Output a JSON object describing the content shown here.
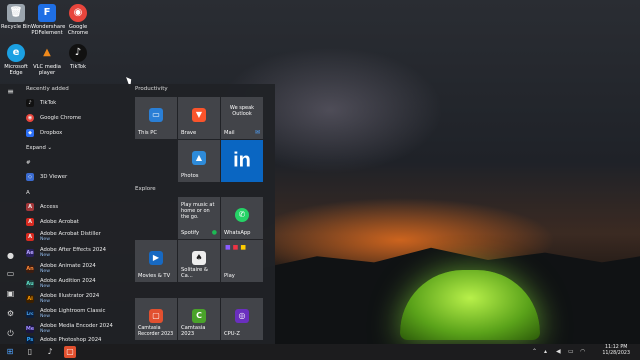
{
  "desktop_icons": [
    {
      "label": "Recycle Bin",
      "icon": "recycle-bin-icon",
      "glyph": "🗑",
      "color": "#9aa4ad"
    },
    {
      "label": "Wondershare PDFelement",
      "icon": "pdfelement-icon",
      "glyph": "F",
      "color": "#1f6fe5"
    },
    {
      "label": "Google Chrome",
      "icon": "chrome-icon",
      "glyph": "◉",
      "color": "#e8453c"
    },
    {
      "label": "Microsoft Edge",
      "icon": "edge-icon",
      "glyph": "e",
      "color": "#1ba0e2"
    },
    {
      "label": "VLC media player",
      "icon": "vlc-icon",
      "glyph": "▲",
      "color": "#f08a1c"
    },
    {
      "label": "TikTok",
      "icon": "tiktok-icon",
      "glyph": "♪",
      "color": "#111"
    }
  ],
  "start_menu": {
    "recently_added": "Recently added",
    "recent": [
      {
        "label": "TikTok",
        "color": "#111",
        "glyph": "♪"
      },
      {
        "label": "Google Chrome",
        "color": "#e8453c",
        "glyph": "◉"
      },
      {
        "label": "Dropbox",
        "color": "#2b6ff6",
        "glyph": "◆"
      }
    ],
    "expand": "Expand",
    "hash": "#",
    "view3d": "3D Viewer",
    "letter_a": "A",
    "apps": [
      {
        "label": "Access",
        "color": "#a4373a",
        "glyph": "A",
        "sub": ""
      },
      {
        "label": "Adobe Acrobat",
        "color": "#d82a20",
        "glyph": "A",
        "sub": ""
      },
      {
        "label": "Adobe Acrobat Distiller",
        "color": "#d82a20",
        "glyph": "A",
        "sub": "New"
      },
      {
        "label": "Adobe After Effects 2024",
        "color": "#2a2060",
        "glyph": "Ae",
        "sub": "New"
      },
      {
        "label": "Adobe Animate 2024",
        "color": "#3a1c10",
        "glyph": "An",
        "sub": "New"
      },
      {
        "label": "Adobe Audition 2024",
        "color": "#1f3b3a",
        "glyph": "Au",
        "sub": "New"
      },
      {
        "label": "Adobe Illustrator 2024",
        "color": "#3a1f00",
        "glyph": "Ai",
        "sub": "New"
      },
      {
        "label": "Adobe Lightroom Classic",
        "color": "#0a2040",
        "glyph": "Lrc",
        "sub": "New"
      },
      {
        "label": "Adobe Media Encoder 2024",
        "color": "#1a1540",
        "glyph": "Me",
        "sub": "New"
      },
      {
        "label": "Adobe Photoshop 2024",
        "color": "#0a1e3a",
        "glyph": "Ps",
        "sub": ""
      }
    ],
    "groups": {
      "productivity": "Productivity",
      "explore": "Explore"
    },
    "tiles": {
      "this_pc": "This PC",
      "brave": "Brave",
      "mail": "Mail",
      "mail_text": "We speak Outlook",
      "photos": "Photos",
      "linkedin": "in",
      "spotify": "Spotify",
      "spotify_text": "Play music at home or on the go.",
      "whatsapp": "WhatsApp",
      "movies": "Movies & TV",
      "solitaire": "Solitaire & Ca...",
      "play": "Play",
      "camtasia_rec": "Camtasia Recorder 2023",
      "camtasia": "Camtasia 2023",
      "cpuz": "CPU-Z"
    }
  },
  "taskbar": {
    "time": "11:12 PM",
    "date": "11/28/2023"
  }
}
